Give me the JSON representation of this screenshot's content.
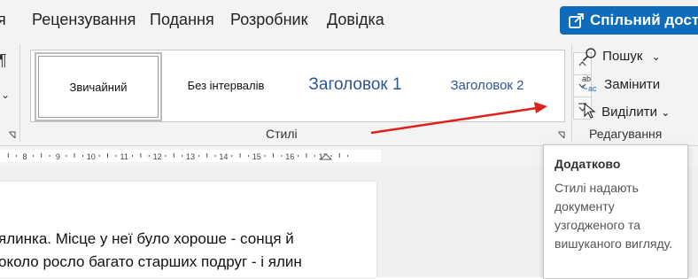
{
  "tabs": [
    "Рецензування",
    "Подання",
    "Розробник",
    "Довідка"
  ],
  "share_button": {
    "label": "Спільний досту",
    "icon": "share-icon"
  },
  "ribbon": {
    "left_partial_icon": "paragraph-mark-icon",
    "styles_gallery": {
      "items": [
        "Звичайний",
        "Без інтервалів",
        "Заголовок 1",
        "Заголовок 2"
      ],
      "selected": "Звичайний"
    },
    "styles_group_label": "Стилі",
    "editing": {
      "find_label": "Пошук",
      "replace_label": "Замінити",
      "select_label": "Виділити",
      "group_label": "Редагування"
    }
  },
  "ruler": {
    "numbers": [
      "8",
      "9",
      "10",
      "11",
      "12",
      "13",
      "14",
      "15",
      "16",
      "17"
    ]
  },
  "document": {
    "lines": [
      "ялинка. Місце у неї було хороше - сонця й",
      "около росло багато старших подруг - і ялин",
      ""
    ]
  },
  "tooltip": {
    "title": "Додатково",
    "description": "Стилі надають документу узгодженого та вишуканого вигляду."
  },
  "colors": {
    "accent": "#0f6cbd",
    "heading": "#2f5496",
    "annotation_arrow": "#e0201c"
  }
}
